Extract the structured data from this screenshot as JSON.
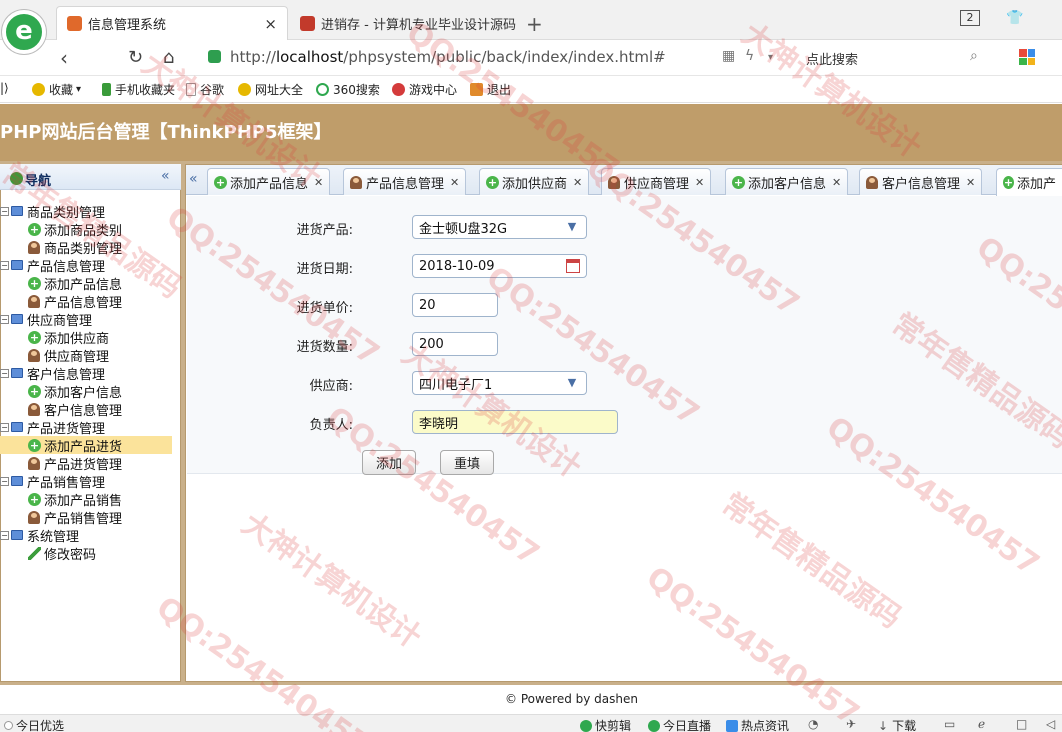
{
  "browser": {
    "tabs": [
      {
        "title": "信息管理系统",
        "active": true
      },
      {
        "title": "进销存 - 计算机专业毕业设计源码",
        "active": false
      }
    ],
    "window_badge": "2",
    "url_prefix": "http://",
    "url_host": "localhost",
    "url_path": "/phpsystem/public/back/index/index.html#",
    "search_placeholder": "点此搜索",
    "bookmarks": [
      {
        "label": "收藏",
        "color": "#e6b800"
      },
      {
        "label": "手机收藏夹",
        "color": "#3a9b3a"
      },
      {
        "label": "谷歌",
        "color": "#999999"
      },
      {
        "label": "网址大全",
        "color": "#e6b800"
      },
      {
        "label": "360搜索",
        "color": "#2fa84f"
      },
      {
        "label": "游戏中心",
        "color": "#d43b3b"
      },
      {
        "label": "退出",
        "color": "#e08a2b"
      }
    ]
  },
  "header": {
    "title": "PHP网站后台管理【ThinkPHP5框架】"
  },
  "sidebar": {
    "title": "导航",
    "groups": [
      {
        "label": "商品类别管理",
        "items": [
          {
            "label": "添加商品类别",
            "icon": "add-icon"
          },
          {
            "label": "商品类别管理",
            "icon": "user-icon"
          }
        ]
      },
      {
        "label": "产品信息管理",
        "items": [
          {
            "label": "添加产品信息",
            "icon": "add-icon"
          },
          {
            "label": "产品信息管理",
            "icon": "user-icon"
          }
        ]
      },
      {
        "label": "供应商管理",
        "items": [
          {
            "label": "添加供应商",
            "icon": "add-icon"
          },
          {
            "label": "供应商管理",
            "icon": "user-icon"
          }
        ]
      },
      {
        "label": "客户信息管理",
        "items": [
          {
            "label": "添加客户信息",
            "icon": "add-icon"
          },
          {
            "label": "客户信息管理",
            "icon": "user-icon"
          }
        ]
      },
      {
        "label": "产品进货管理",
        "items": [
          {
            "label": "添加产品进货",
            "icon": "add-icon",
            "selected": true
          },
          {
            "label": "产品进货管理",
            "icon": "user-icon"
          }
        ]
      },
      {
        "label": "产品销售管理",
        "items": [
          {
            "label": "添加产品销售",
            "icon": "add-icon"
          },
          {
            "label": "产品销售管理",
            "icon": "user-icon"
          }
        ]
      },
      {
        "label": "系统管理",
        "items": [
          {
            "label": "修改密码",
            "icon": "pencil-icon"
          }
        ]
      }
    ]
  },
  "content_tabs": [
    {
      "label": "添加产品信息",
      "icon": "add-icon",
      "closable": true
    },
    {
      "label": "产品信息管理",
      "icon": "user-icon",
      "closable": true
    },
    {
      "label": "添加供应商",
      "icon": "add-icon",
      "closable": true
    },
    {
      "label": "供应商管理",
      "icon": "user-icon",
      "closable": true
    },
    {
      "label": "添加客户信息",
      "icon": "add-icon",
      "closable": true
    },
    {
      "label": "客户信息管理",
      "icon": "user-icon",
      "closable": true
    },
    {
      "label": "添加产",
      "icon": "add-icon",
      "closable": false,
      "active": true
    }
  ],
  "form": {
    "product_label": "进货产品:",
    "product_value": "金士顿U盘32G",
    "date_label": "进货日期:",
    "date_value": "2018-10-09",
    "price_label": "进货单价:",
    "price_value": "20",
    "qty_label": "进货数量:",
    "qty_value": "200",
    "supplier_label": "供应商:",
    "supplier_value": "四川电子厂1",
    "person_label": "负责人:",
    "person_value": "李晓明",
    "submit_label": "添加",
    "reset_label": "重填"
  },
  "footer": {
    "text": "© Powered by dashen"
  },
  "statusbar": {
    "left": "今日优选",
    "items": [
      "快剪辑",
      "今日直播",
      "热点资讯",
      "下载"
    ]
  },
  "watermarks": [
    "大神计算机设计",
    "QQ:254540457",
    "常年售精品源码"
  ]
}
